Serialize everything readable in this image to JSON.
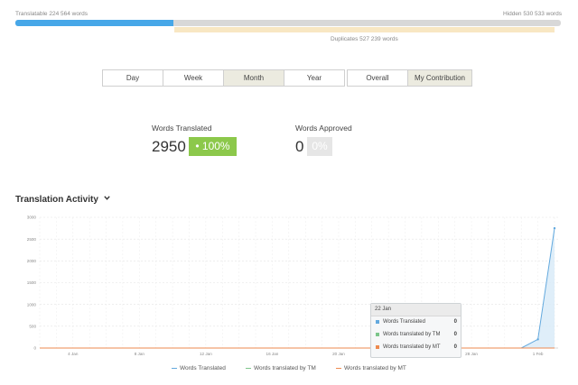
{
  "progress": {
    "translatable_text": "Translatable 224 564 words",
    "hidden_text": "Hidden 530 533 words",
    "duplicates_text": "Duplicates 527 239 words",
    "translatable_fraction": 0.29,
    "colors": {
      "fill": "#47a7e8",
      "track": "#d8d8d8",
      "duplicates": "#f8e7c3"
    }
  },
  "period_buttons": [
    {
      "label": "Day"
    },
    {
      "label": "Week"
    },
    {
      "label": "Month",
      "active": true
    },
    {
      "label": "Year"
    }
  ],
  "scope_buttons": [
    {
      "label": "Overall"
    },
    {
      "label": "My Contribution",
      "active": true
    }
  ],
  "stats": {
    "translated": {
      "label": "Words Translated",
      "value": "2950",
      "badge": "• 100%",
      "badge_color": "#8cc84b"
    },
    "approved": {
      "label": "Words Approved",
      "value": "0",
      "badge": "0%",
      "badge_color": "#e6e6e6"
    }
  },
  "activity": {
    "title": "Translation Activity",
    "icon": "chevron-down-icon"
  },
  "tooltip": {
    "date": "22 Jan",
    "rows": [
      {
        "label": "Words Translated",
        "value": "0",
        "color": "#63a9de"
      },
      {
        "label": "Words translated by TM",
        "value": "0",
        "color": "#7cc58a"
      },
      {
        "label": "Words translated by MT",
        "value": "0",
        "color": "#ee8a4f"
      }
    ]
  },
  "chart_data": {
    "type": "line",
    "x_tick_labels": [
      "4 Jan",
      "8 Jan",
      "12 Jan",
      "16 Jan",
      "20 Jan",
      "24 Jan",
      "28 Jan",
      "1 Feb"
    ],
    "y_ticks": [
      0,
      500,
      1000,
      1500,
      2000,
      2500,
      3000
    ],
    "ylim": [
      0,
      3000
    ],
    "x_dates": [
      "2 Jan",
      "3 Jan",
      "4 Jan",
      "5 Jan",
      "6 Jan",
      "7 Jan",
      "8 Jan",
      "9 Jan",
      "10 Jan",
      "11 Jan",
      "12 Jan",
      "13 Jan",
      "14 Jan",
      "15 Jan",
      "16 Jan",
      "17 Jan",
      "18 Jan",
      "19 Jan",
      "20 Jan",
      "21 Jan",
      "22 Jan",
      "23 Jan",
      "24 Jan",
      "25 Jan",
      "26 Jan",
      "27 Jan",
      "28 Jan",
      "29 Jan",
      "30 Jan",
      "31 Jan",
      "1 Feb",
      "2 Feb"
    ],
    "series": [
      {
        "name": "Words Translated",
        "color": "#63a9de",
        "values": [
          0,
          0,
          0,
          0,
          0,
          0,
          0,
          0,
          0,
          0,
          0,
          0,
          0,
          0,
          0,
          0,
          0,
          0,
          0,
          0,
          0,
          0,
          0,
          0,
          0,
          0,
          0,
          0,
          0,
          0,
          200,
          2750
        ]
      },
      {
        "name": "Words translated by TM",
        "color": "#7cc58a",
        "values": [
          0,
          0,
          0,
          0,
          0,
          0,
          0,
          0,
          0,
          0,
          0,
          0,
          0,
          0,
          0,
          0,
          0,
          0,
          0,
          0,
          0,
          0,
          0,
          0,
          0,
          0,
          0,
          0,
          0,
          0,
          0,
          0
        ]
      },
      {
        "name": "Words translated by MT",
        "color": "#ee8a4f",
        "values": [
          0,
          0,
          0,
          0,
          0,
          0,
          0,
          0,
          0,
          0,
          0,
          0,
          0,
          0,
          0,
          0,
          0,
          0,
          0,
          0,
          0,
          0,
          0,
          0,
          0,
          0,
          0,
          0,
          0,
          0,
          0,
          0
        ]
      }
    ],
    "grid": true,
    "legend_position": "bottom",
    "highlighted_date": "22 Jan"
  }
}
